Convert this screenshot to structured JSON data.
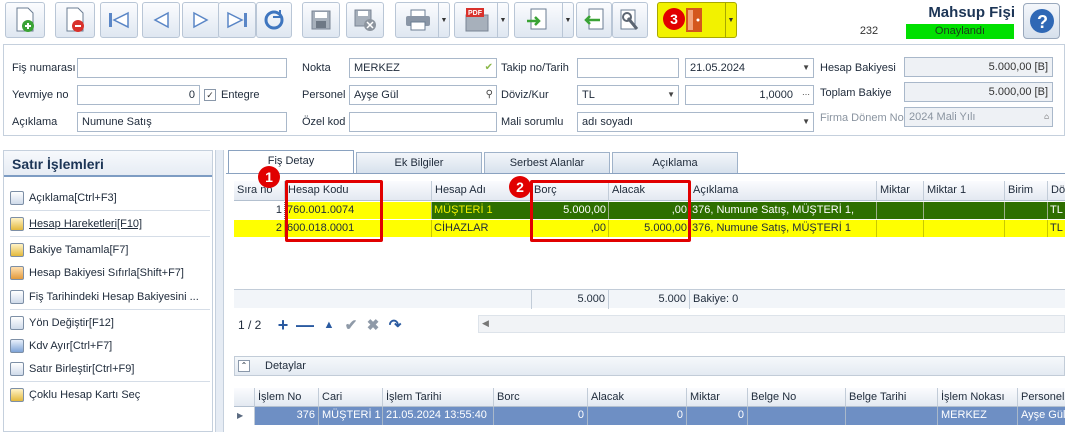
{
  "app": {
    "title": "Mahsup Fişi",
    "record_count": "232",
    "status": "Onaylandı",
    "colors": {
      "status_bg": "#00e000",
      "highlight_yellow": "#ffff00",
      "highlight_green": "#2e6f00",
      "annotation_red": "#e10000",
      "selected_row": "#6e8fc4"
    }
  },
  "toolbar": {
    "icons": [
      "new-document-icon",
      "delete-document-icon",
      "first-record-icon",
      "previous-record-icon",
      "next-record-icon",
      "last-record-icon",
      "refresh-icon",
      "save-icon",
      "save-close-icon",
      "print-icon",
      "pdf-export-icon",
      "import-icon",
      "back-icon",
      "tools-icon",
      "exit-door-icon",
      "help-icon"
    ],
    "pdf_label": "PDF"
  },
  "header": {
    "fis_numarasi": {
      "label": "Fiş numarası",
      "value": ""
    },
    "yevmiye_no": {
      "label": "Yevmiye no",
      "value": "0"
    },
    "entegre": {
      "label": "Entegre",
      "checked": true
    },
    "aciklama": {
      "label": "Açıklama",
      "value": "Numune Satış"
    },
    "nokta": {
      "label": "Nokta",
      "value": "MERKEZ"
    },
    "personel": {
      "label": "Personel",
      "value": "Ayşe Gül"
    },
    "ozel_kod": {
      "label": "Özel kod",
      "value": ""
    },
    "takip_tarih": {
      "label": "Takip no/Tarih",
      "value": "",
      "date": "21.05.2024"
    },
    "doviz_kur": {
      "label": "Döviz/Kur",
      "currency": "TL",
      "rate": "1,0000"
    },
    "mali_sorumlu": {
      "label": "Mali sorumlu",
      "value": "adı soyadı"
    },
    "hesap_bakiyesi": {
      "label": "Hesap Bakiyesi",
      "value": "5.000,00 [B]"
    },
    "toplam_bakiye": {
      "label": "Toplam Bakiye",
      "value": "5.000,00 [B]"
    },
    "firma_donem": {
      "label": "Firma Dönem No",
      "value": "2024 Mali Yılı"
    }
  },
  "left_panel": {
    "title": "Satır İşlemleri",
    "items": [
      "Açıklama[Ctrl+F3]",
      "Hesap Hareketleri[F10]",
      "Bakiye Tamamla[F7]",
      "Hesap Bakiyesi Sıfırla[Shift+F7]",
      "Fiş Tarihindeki Hesap Bakiyesini ...",
      "Yön Değiştir[F12]",
      "Kdv Ayır[Ctrl+F7]",
      "Satır Birleştir[Ctrl+F9]",
      "Çoklu Hesap Kartı Seç"
    ]
  },
  "tabs": [
    "Fiş Detay",
    "Ek Bilgiler",
    "Serbest Alanlar",
    "Açıklama"
  ],
  "grid": {
    "columns": [
      "Sıra no",
      "Hesap Kodu",
      "Hesap Adı",
      "Borç",
      "Alacak",
      "Açıklama",
      "Miktar",
      "Miktar 1",
      "Birim",
      "Döviz"
    ],
    "rows": [
      {
        "sira": "1",
        "kod": "760.001.0074",
        "ad": "MÜŞTERİ 1",
        "borc": "5.000,00",
        "alacak": ",00",
        "aciklama": "376, Numune Satış, MÜŞTERİ 1,",
        "miktar": "",
        "miktar1": "",
        "birim": "",
        "doviz": "TL"
      },
      {
        "sira": "2",
        "kod": "600.018.0001",
        "ad": "CİHAZLAR",
        "borc": ",00",
        "alacak": "5.000,00",
        "aciklama": "376, Numune Satış, MÜŞTERİ 1",
        "miktar": "",
        "miktar1": "",
        "birim": "",
        "doviz": "TL"
      }
    ],
    "sum_borc": "5.000",
    "sum_alacak": "5.000",
    "bakiye": "Bakiye: 0",
    "pager": "1 / 2"
  },
  "annotations": [
    "1",
    "2",
    "3"
  ],
  "details": {
    "title": "Detaylar",
    "columns": [
      "İşlem No",
      "Cari",
      "İşlem Tarihi",
      "Borc",
      "Alacak",
      "Miktar",
      "Belge No",
      "Belge Tarihi",
      "İşlem Nokası",
      "Personel"
    ],
    "row": {
      "islem_no": "376",
      "cari": "MÜŞTERİ 1",
      "tarih": "21.05.2024 13:55:40",
      "borc": "0",
      "alacak": "0",
      "miktar": "0",
      "belge_no": "",
      "belge_tarihi": "",
      "nokta": "MERKEZ",
      "personel": "Ayşe Gül"
    }
  }
}
